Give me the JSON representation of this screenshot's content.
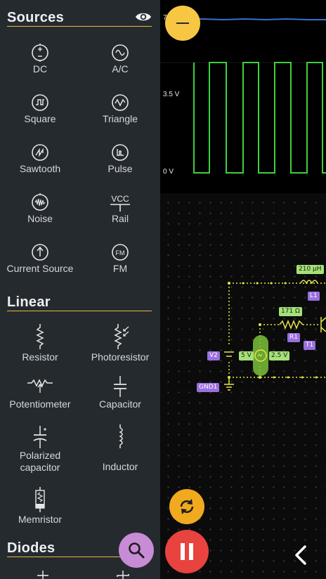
{
  "scope": {
    "label_top": "7",
    "label_mid": "3.5 V",
    "label_zero": "0 V"
  },
  "sidebar": {
    "sources": {
      "title": "Sources",
      "items": [
        {
          "label": "DC",
          "icon": "dc-source-icon"
        },
        {
          "label": "A/C",
          "icon": "ac-source-icon"
        },
        {
          "label": "Square",
          "icon": "square-source-icon"
        },
        {
          "label": "Triangle",
          "icon": "triangle-source-icon"
        },
        {
          "label": "Sawtooth",
          "icon": "sawtooth-source-icon"
        },
        {
          "label": "Pulse",
          "icon": "pulse-source-icon"
        },
        {
          "label": "Noise",
          "icon": "noise-source-icon"
        },
        {
          "label": "Rail",
          "icon": "rail-icon",
          "icon_text": "VCC"
        },
        {
          "label": "Current Source",
          "icon": "current-source-icon"
        },
        {
          "label": "FM",
          "icon": "fm-source-icon",
          "icon_text": "FM"
        }
      ]
    },
    "linear": {
      "title": "Linear",
      "items": [
        {
          "label": "Resistor",
          "icon": "resistor-icon"
        },
        {
          "label": "Photoresistor",
          "icon": "photoresistor-icon"
        },
        {
          "label": "Potentiometer",
          "icon": "potentiometer-icon"
        },
        {
          "label": "Capacitor",
          "icon": "capacitor-icon"
        },
        {
          "label": "Polarized capacitor",
          "icon": "polarized-capacitor-icon"
        },
        {
          "label": "Inductor",
          "icon": "inductor-icon"
        },
        {
          "label": "Memristor",
          "icon": "memristor-icon"
        }
      ]
    },
    "diodes": {
      "title": "Diodes"
    }
  },
  "circuit": {
    "inductor_value": "210 μH",
    "inductor_name": "L1",
    "resistor_value": "171 Ω",
    "resistor_name": "R1",
    "transistor_name": "T1",
    "source_name": "V2",
    "source_amplitude": "5 V",
    "source_offset": "2.5 V",
    "ground_name": "GND1"
  },
  "colors": {
    "accent": "#e8b93a",
    "sidebar_bg": "#252a2f",
    "wire": "#e6e64a",
    "scope_trace": "#3fcf3f",
    "scope_flat": "#3a6fd0",
    "minus_button": "#f7c744",
    "refresh_button": "#f1a91e",
    "pause_button": "#e8433e",
    "search_button": "#c88bd6"
  }
}
